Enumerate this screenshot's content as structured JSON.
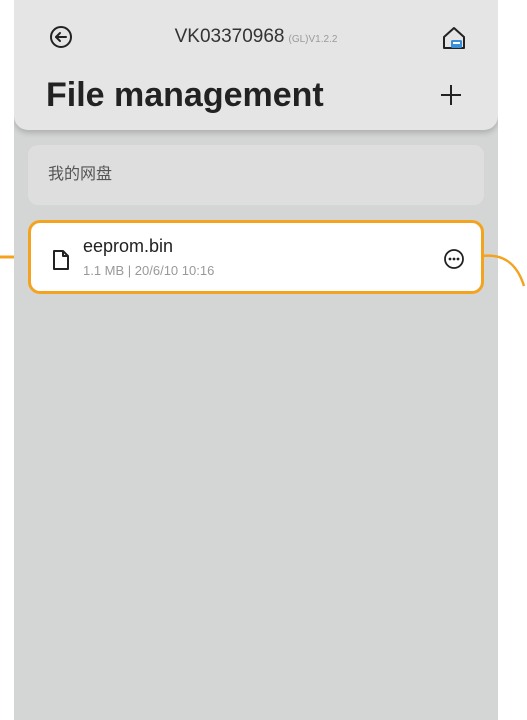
{
  "header": {
    "device_id": "VK03370968",
    "version": "(GL)V1.2.2",
    "back_icon": "back-arrow-circle-icon",
    "home_icon": "home-icon",
    "title": "File management",
    "add_icon": "plus-icon"
  },
  "breadcrumb": {
    "label": "我的网盘"
  },
  "files": [
    {
      "name": "eeprom.bin",
      "meta": "1.1 MB | 20/6/10 10:16",
      "icon": "file-icon",
      "more_icon": "more-options-icon"
    }
  ],
  "colors": {
    "highlight": "#f4a321",
    "background": "#d4d6d5",
    "header": "#e4e5e4",
    "home_accent": "#3a8fd8"
  }
}
